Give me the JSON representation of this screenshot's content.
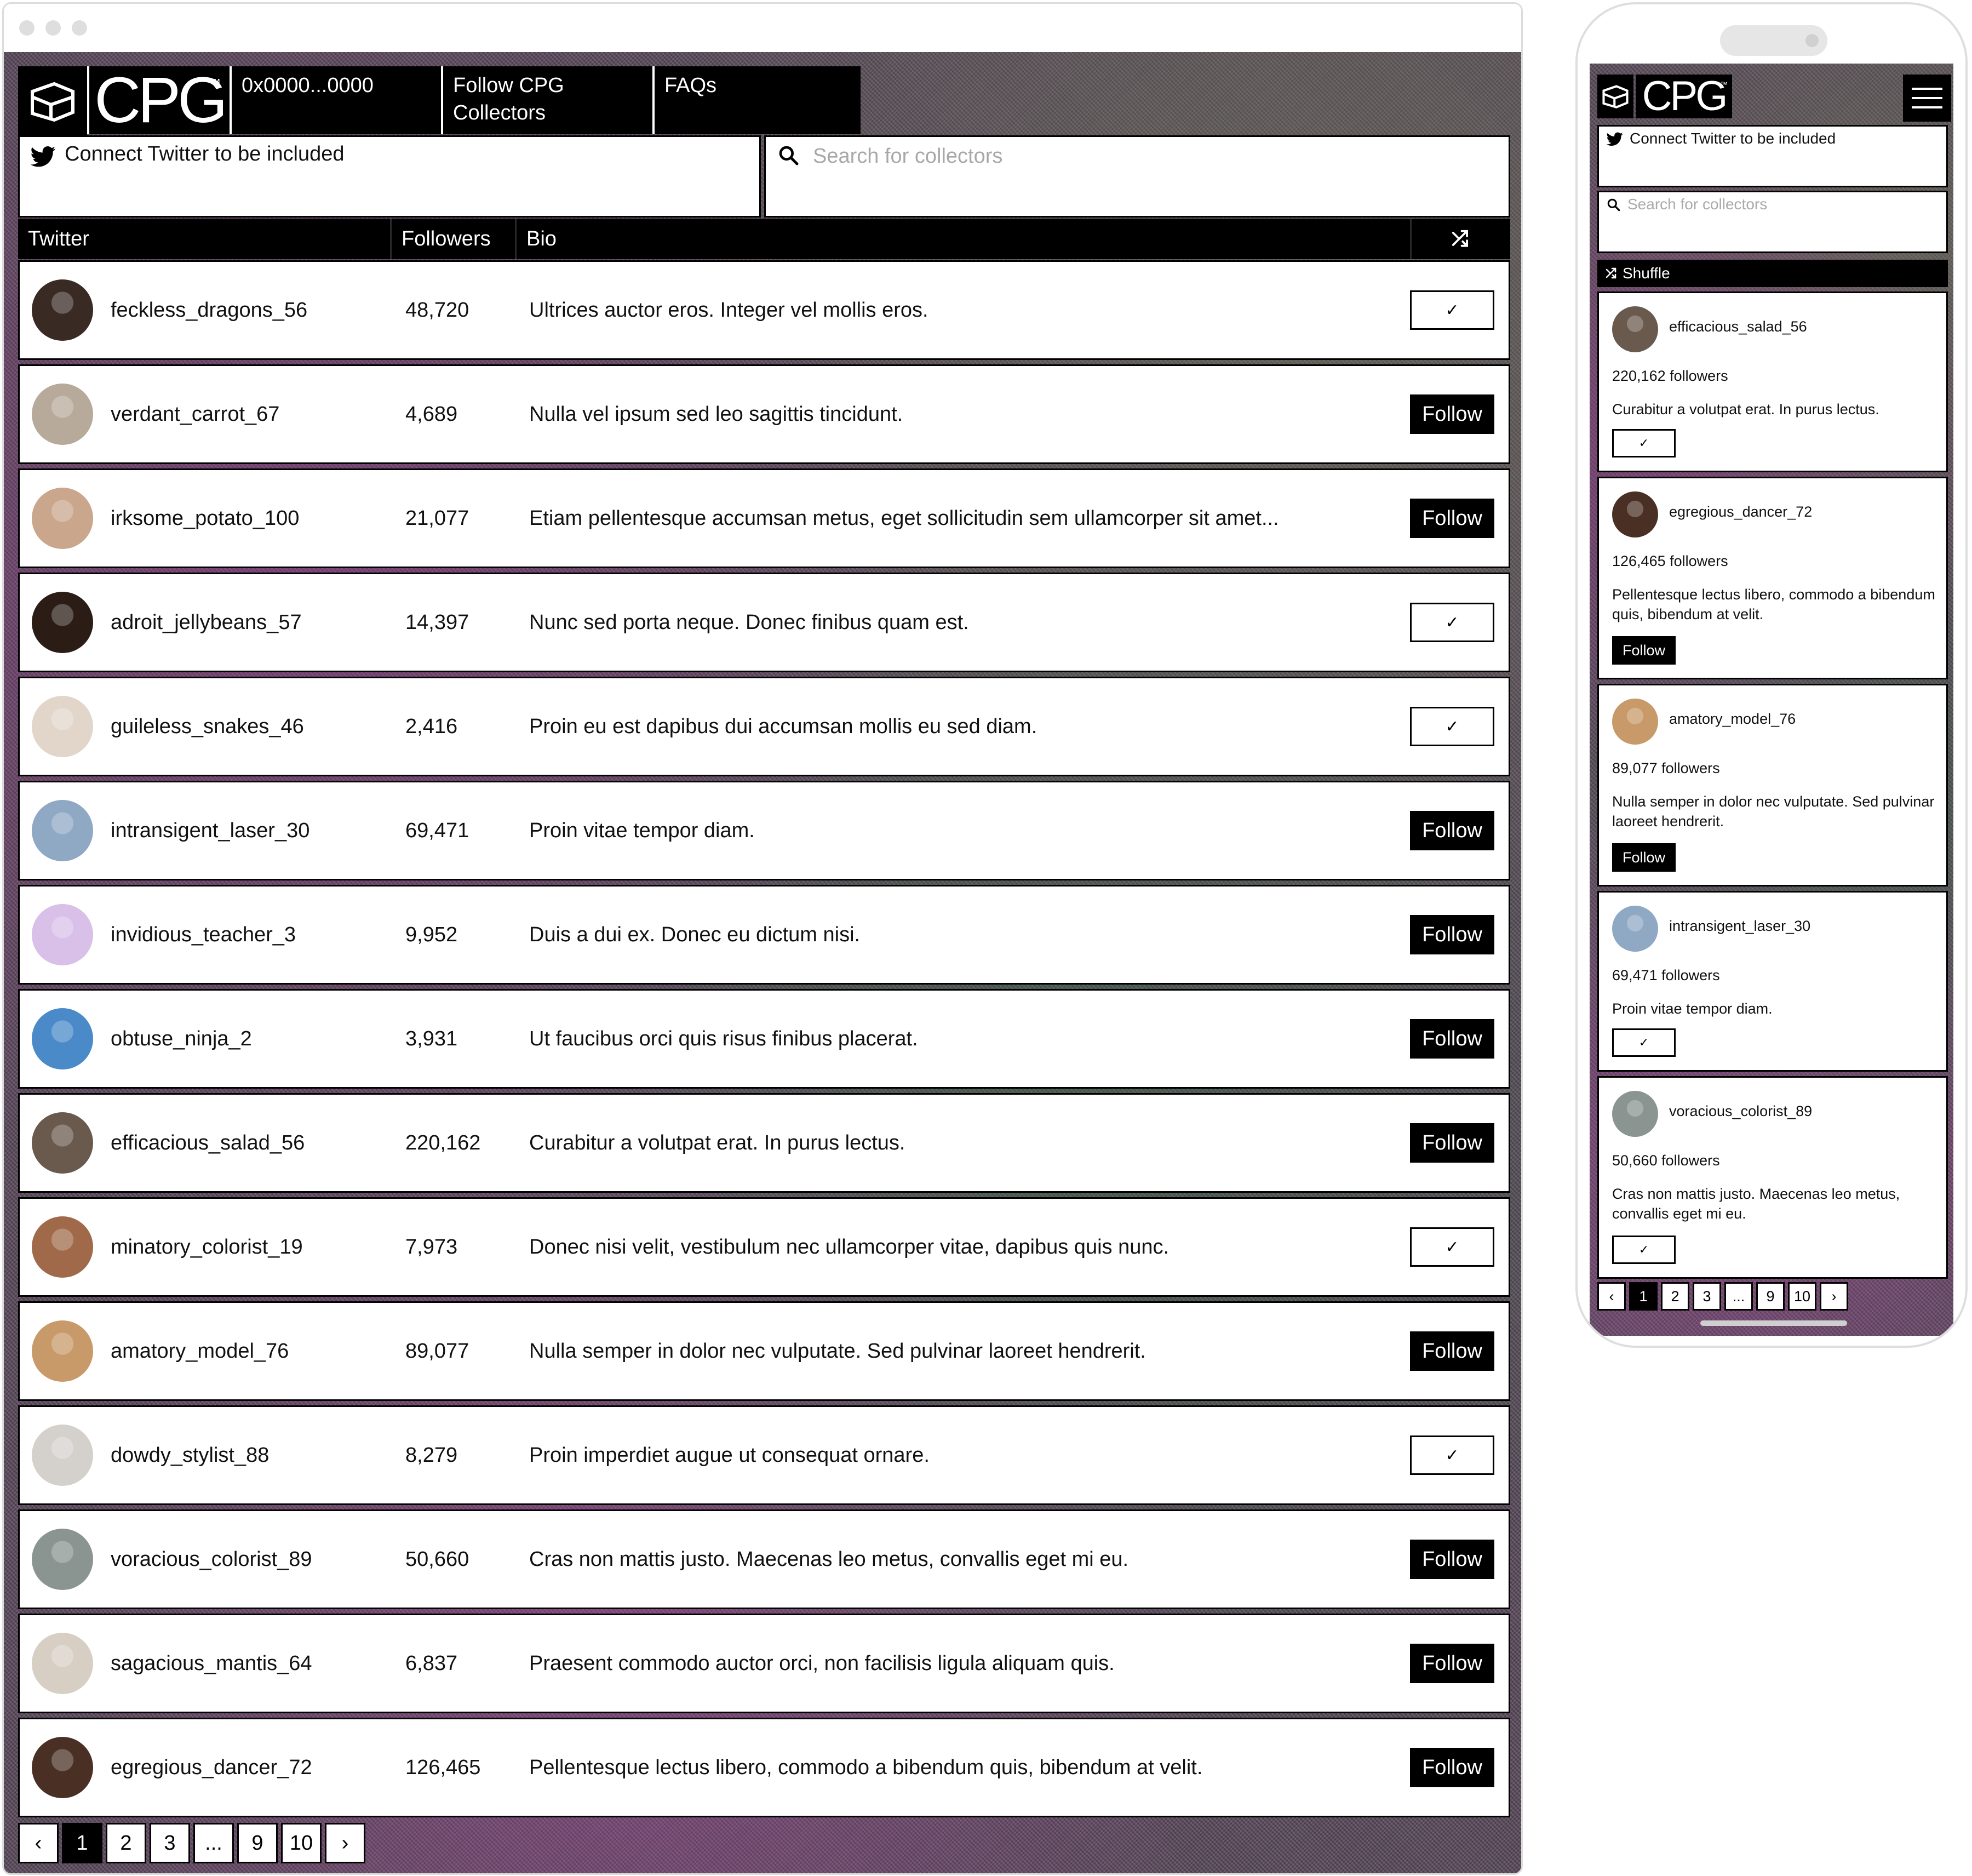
{
  "nav": {
    "brand": "CPG",
    "tm": "™",
    "wallet": "0x0000...0000",
    "follow_line1": "Follow CPG",
    "follow_line2": "Collectors",
    "faqs": "FAQs"
  },
  "connect_twitter": "Connect Twitter to be included",
  "search": {
    "placeholder": "Search for collectors"
  },
  "table": {
    "headers": {
      "twitter": "Twitter",
      "followers": "Followers",
      "bio": "Bio"
    },
    "follow_label": "Follow",
    "checked_label": "✓",
    "rows": [
      {
        "handle": "feckless_dragons_56",
        "followers": "48,720",
        "bio": "Ultrices auctor eros. Integer vel mollis eros.",
        "following": true,
        "avatar_color": "#3a2a24"
      },
      {
        "handle": "verdant_carrot_67",
        "followers": "4,689",
        "bio": "Nulla vel ipsum sed leo sagittis tincidunt.",
        "following": false,
        "avatar_color": "#b8aa9a"
      },
      {
        "handle": "irksome_potato_100",
        "followers": "21,077",
        "bio": "Etiam pellentesque accumsan metus, eget sollicitudin sem ullamcorper sit amet...",
        "following": false,
        "avatar_color": "#caa68c"
      },
      {
        "handle": "adroit_jellybeans_57",
        "followers": "14,397",
        "bio": "Nunc sed porta neque. Donec finibus quam est.",
        "following": true,
        "avatar_color": "#2b1d16"
      },
      {
        "handle": "guileless_snakes_46",
        "followers": "2,416",
        "bio": "Proin eu est dapibus dui accumsan mollis eu sed diam.",
        "following": true,
        "avatar_color": "#e2d6cb"
      },
      {
        "handle": "intransigent_laser_30",
        "followers": "69,471",
        "bio": "Proin vitae tempor diam.",
        "following": false,
        "avatar_color": "#8fa8c4"
      },
      {
        "handle": "invidious_teacher_3",
        "followers": "9,952",
        "bio": "Duis a dui ex. Donec eu dictum nisi.",
        "following": false,
        "avatar_color": "#d8c0e8"
      },
      {
        "handle": "obtuse_ninja_2",
        "followers": "3,931",
        "bio": "Ut faucibus orci quis risus finibus placerat.",
        "following": false,
        "avatar_color": "#4a8ac8"
      },
      {
        "handle": "efficacious_salad_56",
        "followers": "220,162",
        "bio": "Curabitur a volutpat erat. In purus lectus.",
        "following": false,
        "avatar_color": "#6a5a4e"
      },
      {
        "handle": "minatory_colorist_19",
        "followers": "7,973",
        "bio": "Donec nisi velit, vestibulum nec ullamcorper vitae, dapibus quis nunc.",
        "following": true,
        "avatar_color": "#a06a4a"
      },
      {
        "handle": "amatory_model_76",
        "followers": "89,077",
        "bio": "Nulla semper in dolor nec vulputate. Sed pulvinar laoreet hendrerit.",
        "following": false,
        "avatar_color": "#c89a6a"
      },
      {
        "handle": "dowdy_stylist_88",
        "followers": "8,279",
        "bio": "Proin imperdiet augue ut consequat ornare.",
        "following": true,
        "avatar_color": "#d4d0cc"
      },
      {
        "handle": "voracious_colorist_89",
        "followers": "50,660",
        "bio": "Cras non mattis justo. Maecenas leo metus, convallis eget mi eu.",
        "following": false,
        "avatar_color": "#8a9490"
      },
      {
        "handle": "sagacious_mantis_64",
        "followers": "6,837",
        "bio": "Praesent commodo auctor orci, non facilisis ligula aliquam quis.",
        "following": false,
        "avatar_color": "#d8cfc4"
      },
      {
        "handle": "egregious_dancer_72",
        "followers": "126,465",
        "bio": "Pellentesque lectus libero, commodo a bibendum quis, bibendum at velit.",
        "following": false,
        "avatar_color": "#4a3024"
      }
    ]
  },
  "pagination": {
    "prev": "‹",
    "next": "›",
    "pages": [
      "1",
      "2",
      "3",
      "...",
      "9",
      "10"
    ],
    "current": "1"
  },
  "mobile": {
    "shuffle_label": "Shuffle",
    "followers_suffix": " followers",
    "cards": [
      {
        "handle": "efficacious_salad_56",
        "followers": "220,162",
        "bio": "Curabitur a volutpat erat. In purus lectus.",
        "following": true,
        "avatar_color": "#6a5a4e"
      },
      {
        "handle": "egregious_dancer_72",
        "followers": "126,465",
        "bio": "Pellentesque lectus libero, commodo a bibendum quis, bibendum at velit.",
        "following": false,
        "avatar_color": "#4a3024"
      },
      {
        "handle": "amatory_model_76",
        "followers": "89,077",
        "bio": "Nulla semper in dolor nec vulputate. Sed pulvinar laoreet hendrerit.",
        "following": false,
        "avatar_color": "#c89a6a"
      },
      {
        "handle": "intransigent_laser_30",
        "followers": "69,471",
        "bio": "Proin vitae tempor diam.",
        "following": true,
        "avatar_color": "#8fa8c4"
      },
      {
        "handle": "voracious_colorist_89",
        "followers": "50,660",
        "bio": "Cras non mattis justo. Maecenas leo metus, convallis eget mi eu.",
        "following": true,
        "avatar_color": "#8a9490"
      }
    ]
  },
  "icons": {
    "logo": "cpg-logo-icon",
    "twitter": "twitter-bird-icon",
    "search": "search-icon",
    "shuffle": "shuffle-icon",
    "menu": "hamburger-menu-icon",
    "check": "check-icon"
  },
  "colors": {
    "primary": "#000000",
    "surface": "#ffffff",
    "placeholder": "#a8a8a8"
  }
}
